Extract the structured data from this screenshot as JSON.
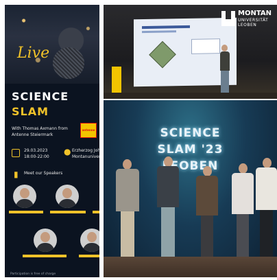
{
  "poster": {
    "live_text": "Live",
    "title_line1": "SCIENCE",
    "title_line2": "SLAM",
    "host_text": "With Thomas Axmann from Antenne Steiermark",
    "logo_text": "antenne",
    "date_line1": "29.03.2023",
    "date_line2": "18:00-22:00",
    "location_line1": "Erzherzog Joh",
    "location_line2": "Montanuniver",
    "speakers_label": "Meet our Speakers",
    "footer": "Participation is free of charge"
  },
  "lecture_photo": {
    "logo": {
      "line1": "MONTAN",
      "line2": "UNIVERSITÄT",
      "line3": "LEOBEN"
    }
  },
  "group_photo": {
    "stage_line1": "SCIENCE",
    "stage_line2": "SLAM '23",
    "stage_line3": "LEOBEN"
  },
  "colors": {
    "poster_bg": "#0b1320",
    "accent_yellow": "#f0c229",
    "stage_teal": "#2d6f87"
  }
}
